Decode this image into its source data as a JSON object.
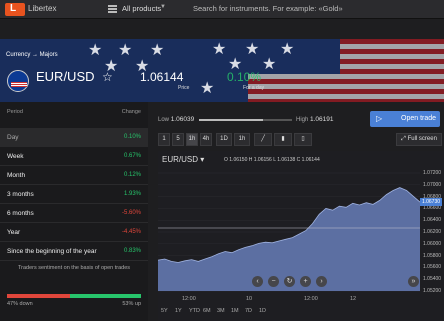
{
  "header": {
    "brand": "Libertex",
    "products_label": "All products",
    "search_placeholder": "Search for instruments. For example: «Gold»"
  },
  "instrument": {
    "breadcrumb": "Currency → Majors",
    "pair": "EUR/USD",
    "price": "1.06144",
    "price_label": "Price",
    "change": "0.10%",
    "change_label": "For a day"
  },
  "performance": {
    "col_period": "Period",
    "col_change": "Change",
    "rows": [
      {
        "period": "Day",
        "change": "0.10%",
        "trend": "pos"
      },
      {
        "period": "Week",
        "change": "0.67%",
        "trend": "pos"
      },
      {
        "period": "Month",
        "change": "0.12%",
        "trend": "pos"
      },
      {
        "period": "3 months",
        "change": "1.93%",
        "trend": "pos"
      },
      {
        "period": "6 months",
        "change": "-5.60%",
        "trend": "neg"
      },
      {
        "period": "Year",
        "change": "-4.45%",
        "trend": "neg"
      },
      {
        "period": "Since the beginning of the year",
        "change": "0.83%",
        "trend": "pos"
      }
    ],
    "sentiment_label": "Traders sentiment on the basis of open trades",
    "down": "47% down",
    "up": "53% up",
    "down_fraction": 0.47
  },
  "range": {
    "low_label": "Low",
    "low": "1.06039",
    "high_label": "High",
    "high": "1.06191",
    "position_fraction": 0.69
  },
  "trade_button": "Open trade",
  "toolbar": {
    "timeframes": [
      "1",
      "5",
      "1h",
      "4h",
      "1D",
      "1h"
    ],
    "active_index": 2,
    "fullscreen": "Full screen"
  },
  "chart_data": {
    "type": "area",
    "symbol": "EUR/USD",
    "ohlc": "O 1.06150  H 1.06156  L 1.06138  C 1.06144",
    "x_ticks": [
      "12:00",
      "10",
      "12:00",
      "12"
    ],
    "y_ticks": [
      "1.07200",
      "1.07000",
      "1.06800",
      "1.06600",
      "1.06400",
      "1.06200",
      "1.06000",
      "1.05800",
      "1.05600",
      "1.05400",
      "1.05200"
    ],
    "current_price": "1.06730",
    "ylim": [
      1.052,
      1.073
    ],
    "values": [
      1.0573,
      1.0575,
      1.0571,
      1.0569,
      1.0572,
      1.0574,
      1.0571,
      1.0575,
      1.0579,
      1.0584,
      1.0588,
      1.0586,
      1.0591,
      1.0595,
      1.0598,
      1.0602,
      1.0604,
      1.0603,
      1.0606,
      1.0609,
      1.0612,
      1.0618,
      1.0624,
      1.0636,
      1.0652,
      1.0662,
      1.0659,
      1.0666,
      1.0664,
      1.0671,
      1.0668,
      1.0672,
      1.0669,
      1.0676,
      1.0686,
      1.0693,
      1.0698,
      1.0693,
      1.0683,
      1.0673
    ],
    "periods": [
      "5Y",
      "1Y",
      "YTD",
      "6M",
      "3M",
      "1M",
      "7D",
      "1D"
    ]
  }
}
